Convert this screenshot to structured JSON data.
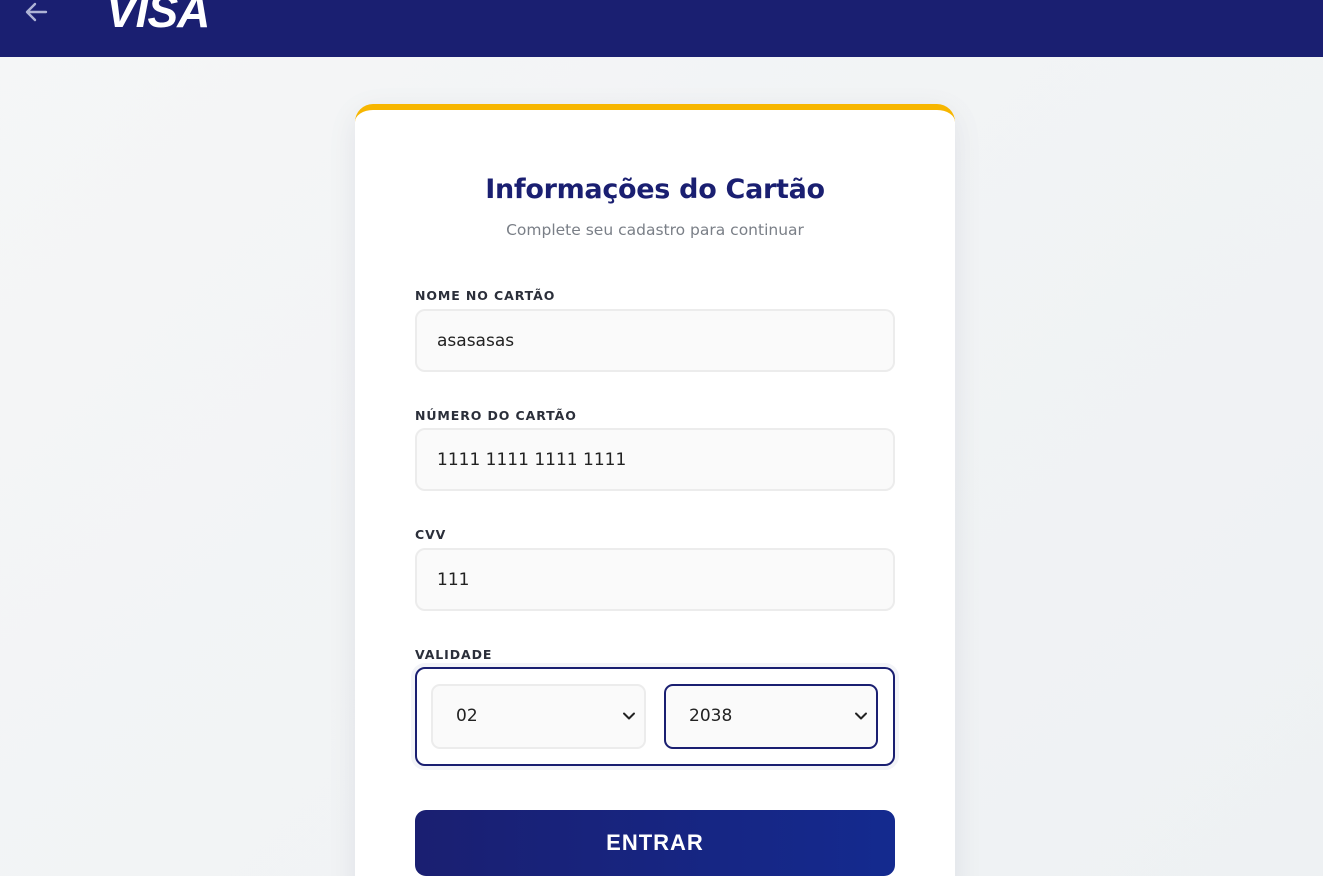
{
  "header": {
    "back_icon": "arrow-left-icon",
    "brand": "VISA",
    "background": "#1a1f71"
  },
  "form": {
    "title": "Informações do Cartão",
    "subtitle": "Complete seu cadastro para continuar",
    "name": {
      "label": "NOME NO CARTÃO",
      "value": "asasasas"
    },
    "number": {
      "label": "NÚMERO DO CARTÃO",
      "value": "1111 1111 1111 1111"
    },
    "cvv": {
      "label": "CVV",
      "value": "111"
    },
    "validity": {
      "label": "VALIDADE",
      "month": "02",
      "year": "2038"
    },
    "submit_label": "ENTRAR"
  },
  "colors": {
    "primary": "#1a1f71",
    "accent": "#f7b600"
  }
}
